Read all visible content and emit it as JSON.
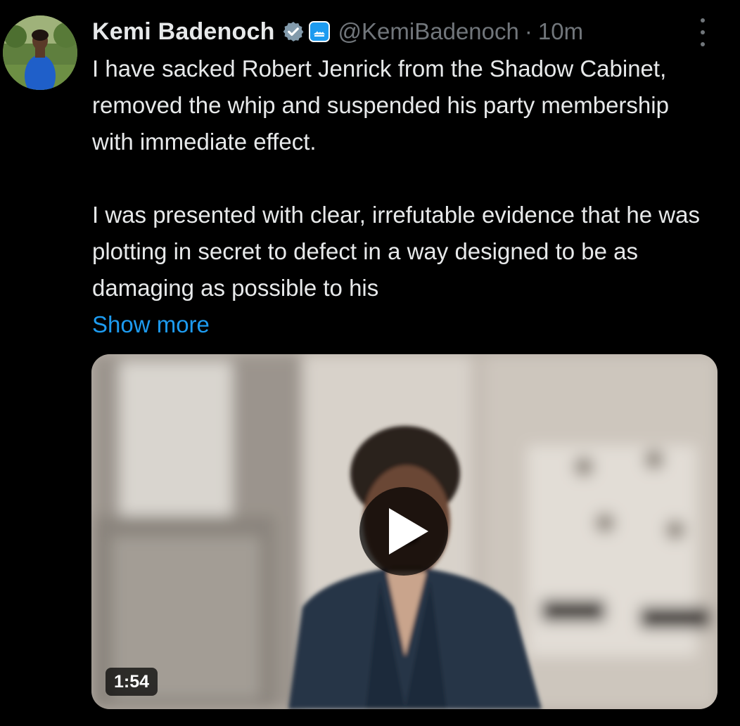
{
  "tweet": {
    "author": {
      "display_name": "Kemi Badenoch",
      "handle": "@KemiBadenoch",
      "verified_icon": "verified-badge-icon",
      "affiliation_icon": "affiliation-badge-icon"
    },
    "separator": "·",
    "timestamp": "10m",
    "more_icon": "more-options-icon",
    "text": {
      "paragraph_1": "I have sacked Robert Jenrick from the Shadow Cabinet, removed the whip and suspended his party membership with immediate effect.",
      "paragraph_2": "I was presented with clear, irrefutable evidence that he was plotting in secret to defect in a way designed to be as damaging as possible to his"
    },
    "show_more": "Show more",
    "media": {
      "type": "video",
      "duration": "1:54",
      "play_icon": "play-icon"
    }
  },
  "colors": {
    "background": "#000000",
    "text_primary": "#e7e9ea",
    "text_secondary": "#71767b",
    "link": "#1d9bf0"
  }
}
